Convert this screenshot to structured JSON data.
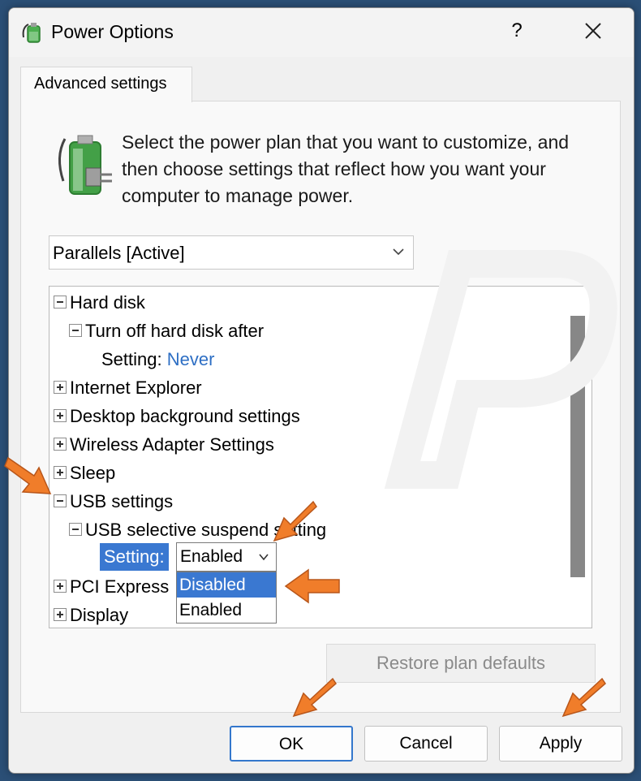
{
  "window": {
    "title": "Power Options",
    "help_label": "?"
  },
  "tab": {
    "label": "Advanced settings"
  },
  "description": "Select the power plan that you want to customize, and then choose settings that reflect how you want your computer to manage power.",
  "plan_select": {
    "value": "Parallels [Active]"
  },
  "tree": {
    "hard_disk": "Hard disk",
    "turn_off_hard_disk": "Turn off hard disk after",
    "hd_setting_label": "Setting:",
    "hd_setting_value": "Never",
    "internet_explorer": "Internet Explorer",
    "desktop_background": "Desktop background settings",
    "wireless_adapter": "Wireless Adapter Settings",
    "sleep": "Sleep",
    "usb_settings": "USB settings",
    "usb_selective": "USB selective suspend setting",
    "usb_setting_label": "Setting:",
    "usb_setting_value": "Enabled",
    "pci_express": "PCI Express",
    "display": "Display"
  },
  "dropdown": {
    "options": [
      "Disabled",
      "Enabled"
    ],
    "highlighted": "Disabled"
  },
  "buttons": {
    "restore": "Restore plan defaults",
    "ok": "OK",
    "cancel": "Cancel",
    "apply": "Apply"
  },
  "colors": {
    "accent": "#3a78d1",
    "arrow": "#f07d2a",
    "link_blue": "#2e6fc4"
  },
  "icons": [
    "power-plug-icon",
    "power-battery-icon",
    "close-icon",
    "chevron-down-icon",
    "expand-icon",
    "collapse-icon",
    "orange-arrow-icon"
  ]
}
